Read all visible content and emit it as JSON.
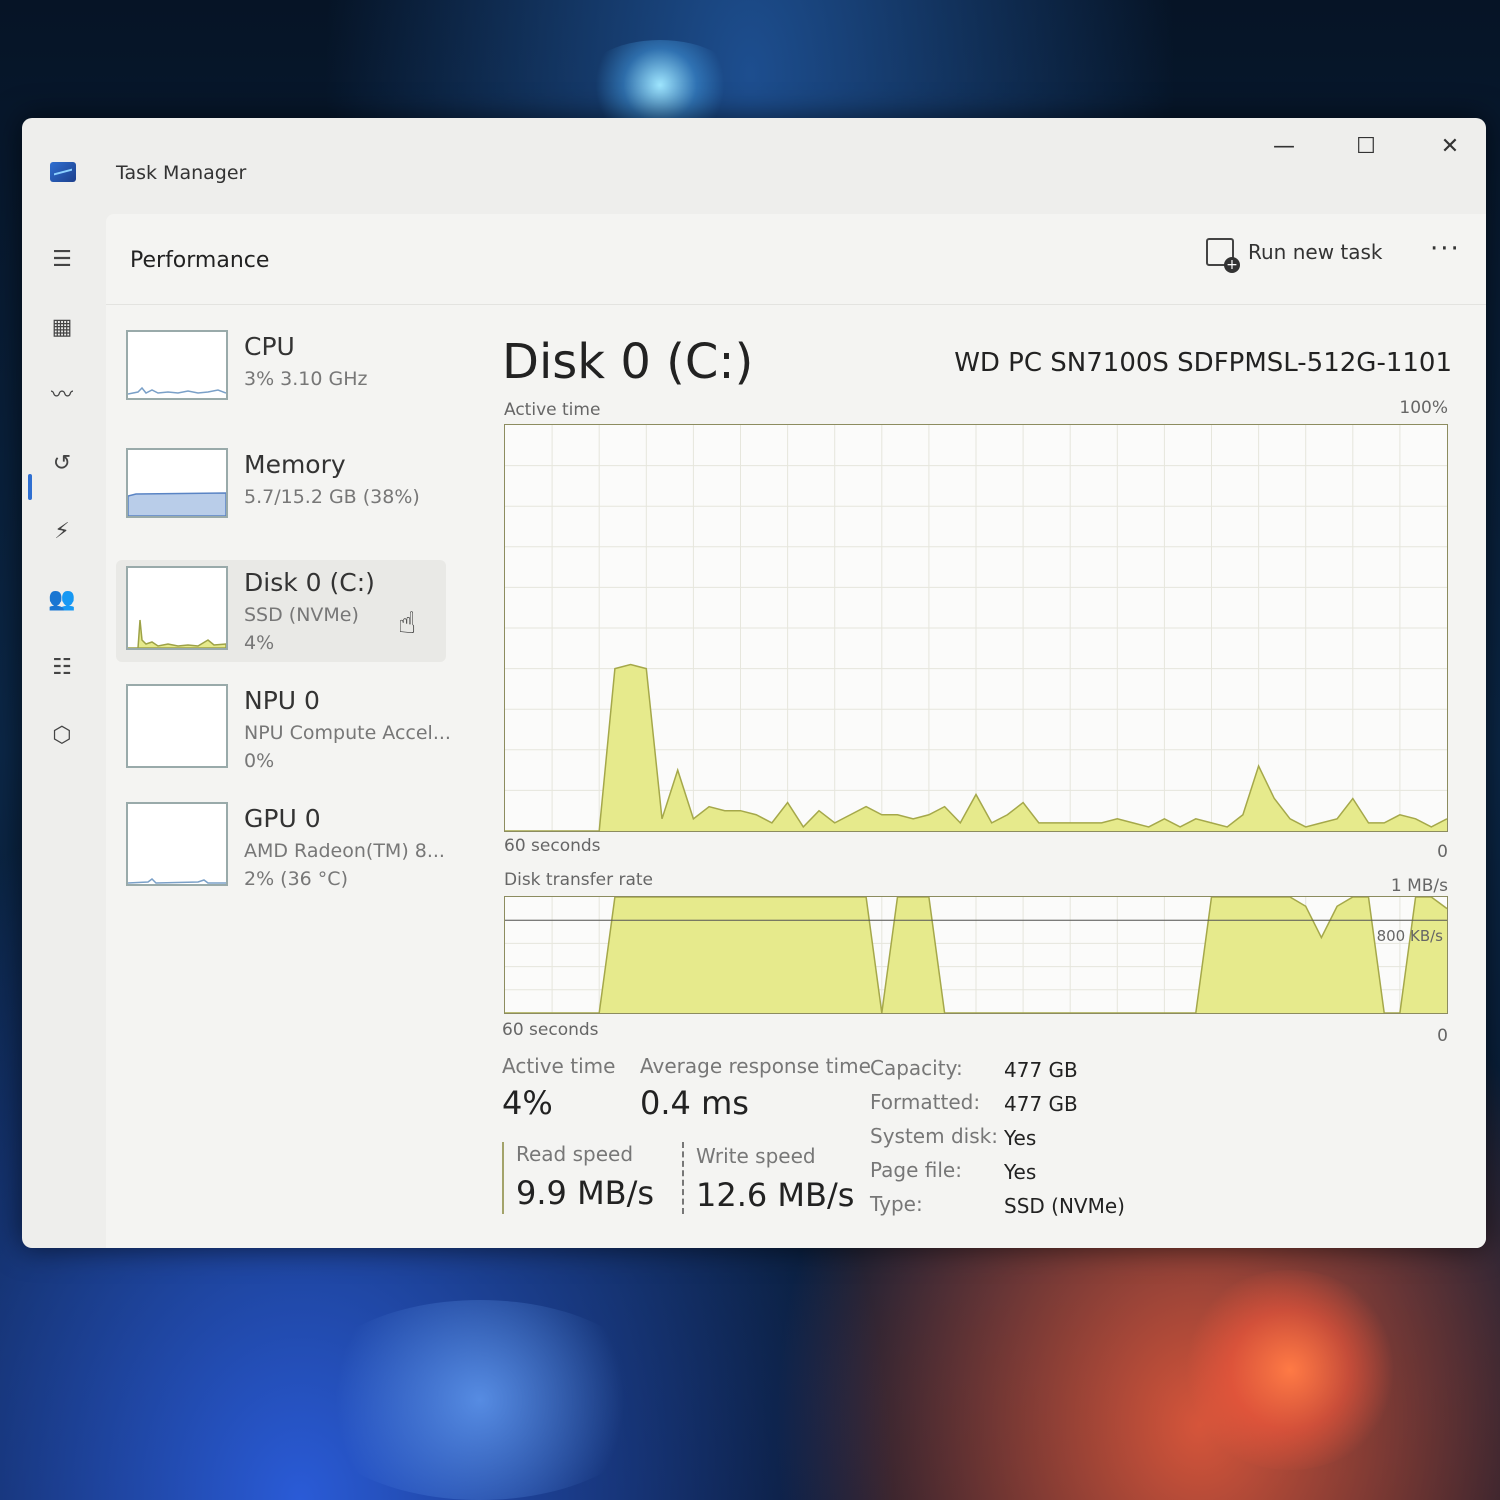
{
  "window": {
    "title": "Task Manager"
  },
  "controls": {
    "minimize": "—",
    "maximize": "☐",
    "close": "✕"
  },
  "header": {
    "title": "Performance",
    "run_new_task": "Run new task",
    "more": "···"
  },
  "devices": [
    {
      "name": "CPU",
      "sub": "3% 3.10 GHz",
      "sub2": ""
    },
    {
      "name": "Memory",
      "sub": "5.7/15.2 GB (38%)",
      "sub2": ""
    },
    {
      "name": "Disk 0 (C:)",
      "sub": "SSD (NVMe)",
      "sub2": "4%"
    },
    {
      "name": "NPU 0",
      "sub": "NPU Compute Accel...",
      "sub2": "0%"
    },
    {
      "name": "GPU 0",
      "sub": "AMD Radeon(TM) 8...",
      "sub2": "2% (36 °C)"
    }
  ],
  "detail": {
    "title": "Disk 0 (C:)",
    "model": "WD PC SN7100S SDFPMSL-512G-1101",
    "active_time_label": "Active time",
    "active_time_max": "100%",
    "x_left": "60 seconds",
    "x_right": "0",
    "transfer_label": "Disk transfer rate",
    "transfer_max": "1 MB/s",
    "transfer_mid": "800 KB/s"
  },
  "stats": {
    "active_time_label": "Active time",
    "active_time": "4%",
    "avg_response_label": "Average response time",
    "avg_response": "0.4 ms",
    "read_label": "Read speed",
    "read": "9.9 MB/s",
    "write_label": "Write speed",
    "write": "12.6 MB/s"
  },
  "properties": [
    {
      "label": "Capacity:",
      "value": "477 GB"
    },
    {
      "label": "Formatted:",
      "value": "477 GB"
    },
    {
      "label": "System disk:",
      "value": "Yes"
    },
    {
      "label": "Page file:",
      "value": "Yes"
    },
    {
      "label": "Type:",
      "value": "SSD (NVMe)"
    }
  ],
  "colors": {
    "accent": "#2f6fd1",
    "disk_fill": "#e6ea8c",
    "disk_line": "#a5a84a"
  },
  "chart_data": [
    {
      "type": "area",
      "title": "Active time",
      "ylim": [
        0,
        100
      ],
      "y_unit": "%",
      "x": [
        0,
        1,
        2,
        3,
        4,
        5,
        6,
        7,
        8,
        9,
        10,
        11,
        12,
        13,
        14,
        15,
        16,
        17,
        18,
        19,
        20,
        21,
        22,
        23,
        24,
        25,
        26,
        27,
        28,
        29,
        30,
        31,
        32,
        33,
        34,
        35,
        36,
        37,
        38,
        39,
        40,
        41,
        42,
        43,
        44,
        45,
        46,
        47,
        48,
        49,
        50,
        51,
        52,
        53,
        54,
        55,
        56,
        57,
        58,
        59,
        60
      ],
      "values": [
        0,
        0,
        0,
        0,
        0,
        0,
        0,
        40,
        41,
        40,
        3,
        15,
        3,
        6,
        5,
        5,
        4,
        2,
        7,
        1,
        5,
        2,
        4,
        6,
        4,
        4,
        3,
        4,
        6,
        2,
        9,
        2,
        4,
        7,
        2,
        2,
        2,
        2,
        2,
        3,
        2,
        1,
        3,
        1,
        3,
        2,
        1,
        4,
        16,
        8,
        3,
        1,
        2,
        3,
        8,
        2,
        2,
        4,
        3,
        1,
        3
      ]
    },
    {
      "type": "area",
      "title": "Disk transfer rate",
      "ylim": [
        0,
        1
      ],
      "y_unit": "MB/s",
      "x": [
        0,
        1,
        2,
        3,
        4,
        5,
        6,
        7,
        8,
        9,
        10,
        11,
        12,
        13,
        14,
        15,
        16,
        17,
        18,
        19,
        20,
        21,
        22,
        23,
        24,
        25,
        26,
        27,
        28,
        29,
        30,
        31,
        32,
        33,
        34,
        35,
        36,
        37,
        38,
        39,
        40,
        41,
        42,
        43,
        44,
        45,
        46,
        47,
        48,
        49,
        50,
        51,
        52,
        53,
        54,
        55,
        56,
        57,
        58,
        59,
        60
      ],
      "values": [
        0,
        0,
        0,
        0,
        0,
        0,
        0,
        1,
        1,
        1,
        1,
        1,
        1,
        1,
        1,
        1,
        1,
        1,
        1,
        1,
        1,
        1,
        1,
        1,
        0,
        1,
        1,
        1,
        0,
        0,
        0,
        0,
        0,
        0,
        0,
        0,
        0,
        0,
        0,
        0,
        0,
        0,
        0,
        0,
        0,
        1,
        1,
        1,
        1,
        1,
        1,
        0.92,
        0.65,
        0.92,
        1,
        1,
        0,
        0,
        1,
        1,
        0.9
      ]
    }
  ]
}
